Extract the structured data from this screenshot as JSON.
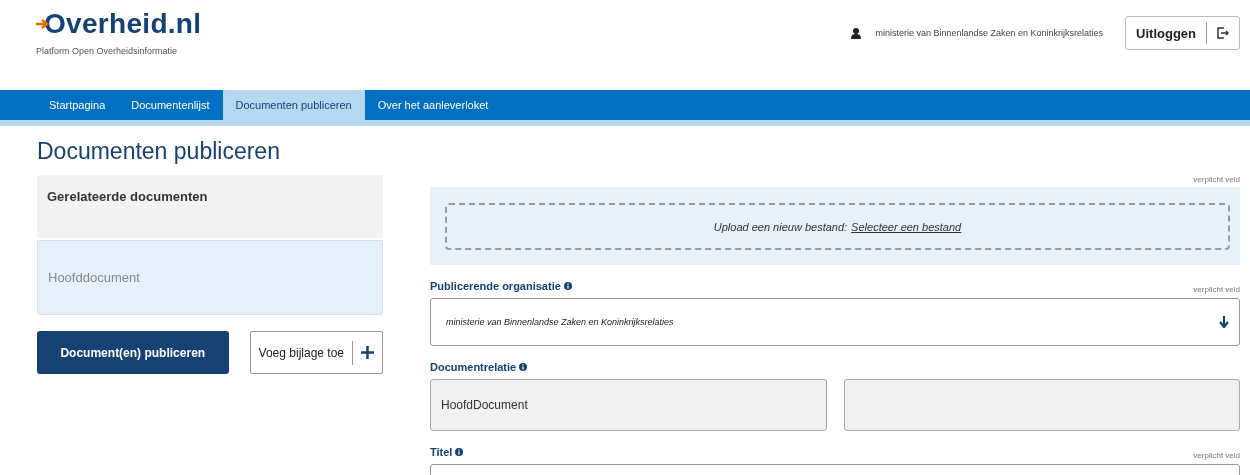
{
  "header": {
    "logo": "Overheid.nl",
    "subtitle": "Platform Open Overheidsinformatie",
    "user": "ministerie van Binnenlandse Zaken en Koninkrijksrelaties",
    "logout_button": "Uitloggen"
  },
  "nav": [
    {
      "label": "Startpagina",
      "selected": false
    },
    {
      "label": "Documentenlijst",
      "selected": false
    },
    {
      "label": "Documenten publiceren",
      "selected": true
    },
    {
      "label": "Over het aanleverloket",
      "selected": false
    }
  ],
  "page_title": "Documenten publiceren",
  "related_documents": {
    "heading": "Gerelateerde documenten",
    "items": [
      {
        "label": "Hoofddocument",
        "selected": true
      }
    ]
  },
  "buttons": [
    {
      "kind": "primary",
      "label": "Document(en) publiceren"
    },
    {
      "kind": "add",
      "label": "Voeg bijlage toe"
    }
  ],
  "form": {
    "required_note": "verplicht veld",
    "upload": {
      "text": "Upload een nieuw bestand:",
      "link": "Selecteer een bestand"
    },
    "fields": [
      {
        "kind": "select",
        "label": "Publicerende organisatie",
        "required_note": "verplicht veld",
        "value": "ministerie van Binnenlandse Zaken en Koninkrijksrelaties"
      },
      {
        "kind": "pair",
        "label": "Documentrelatie",
        "value": "HoofdDocument"
      },
      {
        "kind": "text",
        "label": "Titel",
        "required_note": "verplicht veld"
      }
    ]
  }
}
